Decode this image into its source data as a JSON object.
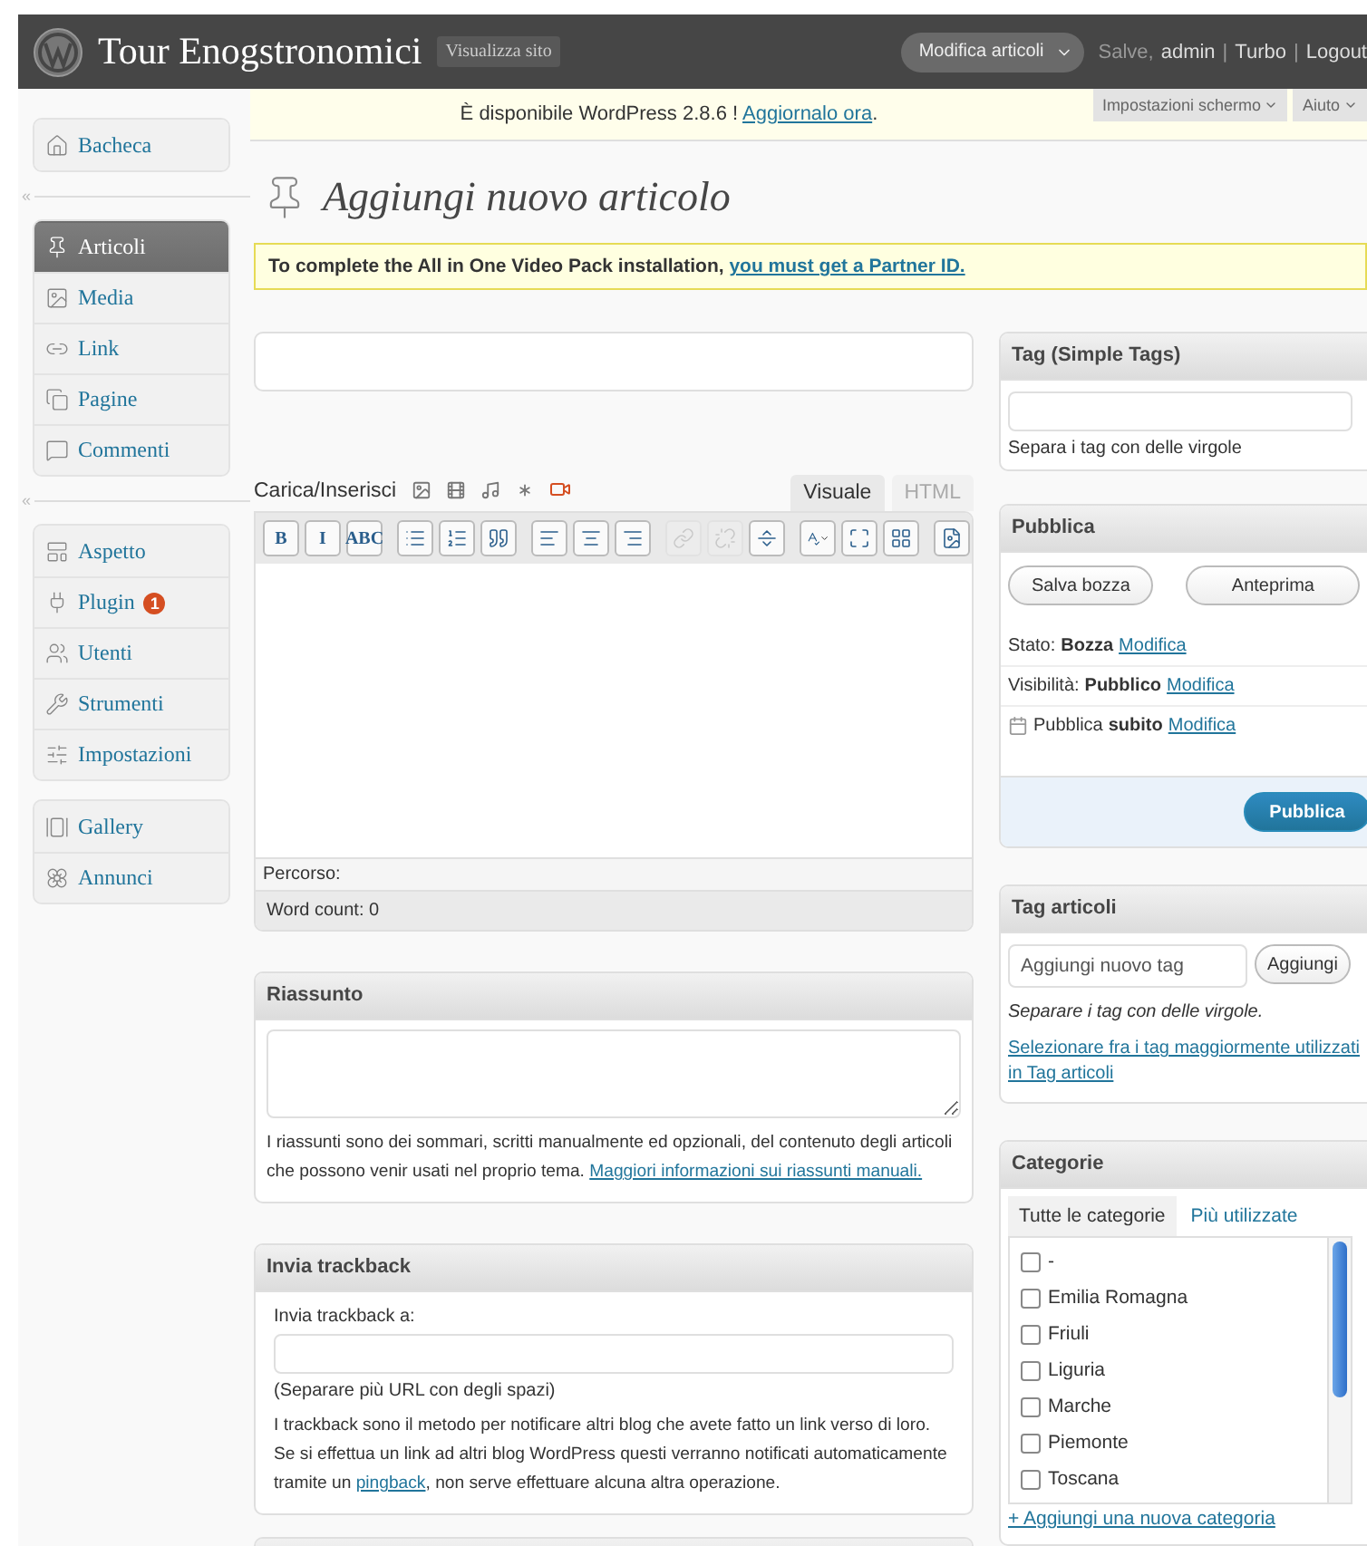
{
  "header": {
    "site_title": "Tour Enogstronomici",
    "view_site": "Visualizza sito",
    "menu_button": "Modifica articoli",
    "greeting": "Salve,",
    "user": "admin",
    "separator": "|",
    "links": [
      "Turbo",
      "Logout"
    ]
  },
  "sidebar": {
    "groups": [
      {
        "items": [
          {
            "label": "Bacheca",
            "selected": false
          }
        ]
      },
      {
        "collapse_mark": "«",
        "items": [
          {
            "label": "Articoli",
            "selected": true
          },
          {
            "label": "Media",
            "selected": false
          },
          {
            "label": "Link",
            "selected": false
          },
          {
            "label": "Pagine",
            "selected": false
          },
          {
            "label": "Commenti",
            "selected": false
          }
        ]
      },
      {
        "collapse_mark": "«",
        "items": [
          {
            "label": "Aspetto",
            "selected": false
          },
          {
            "label": "Plugin",
            "selected": false,
            "badge": "1"
          },
          {
            "label": "Utenti",
            "selected": false
          },
          {
            "label": "Strumenti",
            "selected": false
          },
          {
            "label": "Impostazioni",
            "selected": false
          }
        ]
      },
      {
        "items": [
          {
            "label": "Gallery",
            "selected": false
          },
          {
            "label": "Annunci",
            "selected": false
          }
        ]
      }
    ]
  },
  "update_nag": {
    "text": "È disponibile WordPress 2.8.6 ! ",
    "link": "Aggiornalo ora",
    "after": "."
  },
  "screen_tabs": [
    "Impostazioni schermo",
    "Aiuto"
  ],
  "heading": "Aggiungi nuovo articolo",
  "notice": {
    "text": "To complete the All in One Video Pack installation, ",
    "link": "you must get a Partner ID."
  },
  "editor": {
    "upload_label": "Carica/Inserisci",
    "tabs": [
      {
        "label": "Visuale",
        "selected": true
      },
      {
        "label": "HTML",
        "selected": false
      }
    ],
    "toolbar": [
      {
        "label": "B",
        "disabled": false
      },
      {
        "label": "I",
        "disabled": false
      },
      {
        "label": "ABC",
        "disabled": false
      },
      {
        "disabled": false
      },
      {
        "disabled": false
      },
      {
        "disabled": false
      },
      {
        "disabled": false
      },
      {
        "disabled": false
      },
      {
        "disabled": false
      },
      {
        "disabled": true
      },
      {
        "disabled": true
      },
      {
        "disabled": false
      },
      {
        "disabled": false
      },
      {
        "disabled": false
      },
      {
        "disabled": false
      },
      {
        "disabled": false
      }
    ],
    "path_label": "Percorso:",
    "word_count": "Word count: 0"
  },
  "excerpt": {
    "title": "Riassunto",
    "help": "I riassunti sono dei sommari, scritti manualmente ed opzionali, del contenuto degli articoli che possono venir usati nel proprio tema. ",
    "link": "Maggiori informazioni sui riassunti manuali."
  },
  "trackbacks": {
    "title": "Invia trackback",
    "label": "Invia trackback a:",
    "hint": "(Separare più URL con degli spazi)",
    "help_before": "I trackback sono il metodo per notificare altri blog che avete fatto un link verso di loro. Se si effettua un link ad altri blog WordPress questi verranno notificati automaticamente tramite un ",
    "help_link": "pingback",
    "help_after": ", non serve effettuare alcuna altra operazione."
  },
  "simple_tags": {
    "title": "Tag (Simple Tags)",
    "hint": "Separa i tag con delle virgole"
  },
  "publish": {
    "title": "Pubblica",
    "save_draft": "Salva bozza",
    "preview": "Anteprima",
    "rows": [
      {
        "kind": "plain",
        "label": "Stato:",
        "value": "Bozza",
        "link": "Modifica"
      },
      {
        "kind": "plain",
        "label": "Visibilità:",
        "value": "Pubblico",
        "link": "Modifica"
      },
      {
        "kind": "calendar",
        "label": "Pubblica",
        "value": "subito",
        "link": "Modifica"
      }
    ],
    "publish_button": "Pubblica"
  },
  "post_tags": {
    "title": "Tag articoli",
    "placeholder": "Aggiungi nuovo tag",
    "button": "Aggiungi",
    "hint": "Separare i tag con delle virgole.",
    "link": "Selezionare fra i tag maggiormente utilizzati in Tag articoli"
  },
  "categories": {
    "title": "Categorie",
    "tabs": [
      {
        "label": "Tutte le categorie",
        "selected": true
      },
      {
        "label": "Più utilizzate",
        "selected": false
      }
    ],
    "items": [
      {
        "label": "-",
        "checked": false
      },
      {
        "label": "Emilia Romagna",
        "checked": false
      },
      {
        "label": "Friuli",
        "checked": false
      },
      {
        "label": "Liguria",
        "checked": false
      },
      {
        "label": "Marche",
        "checked": false
      },
      {
        "label": "Piemonte",
        "checked": false
      },
      {
        "label": "Toscana",
        "checked": false
      }
    ],
    "add_link": "+ Aggiungi una nuova categoria"
  }
}
